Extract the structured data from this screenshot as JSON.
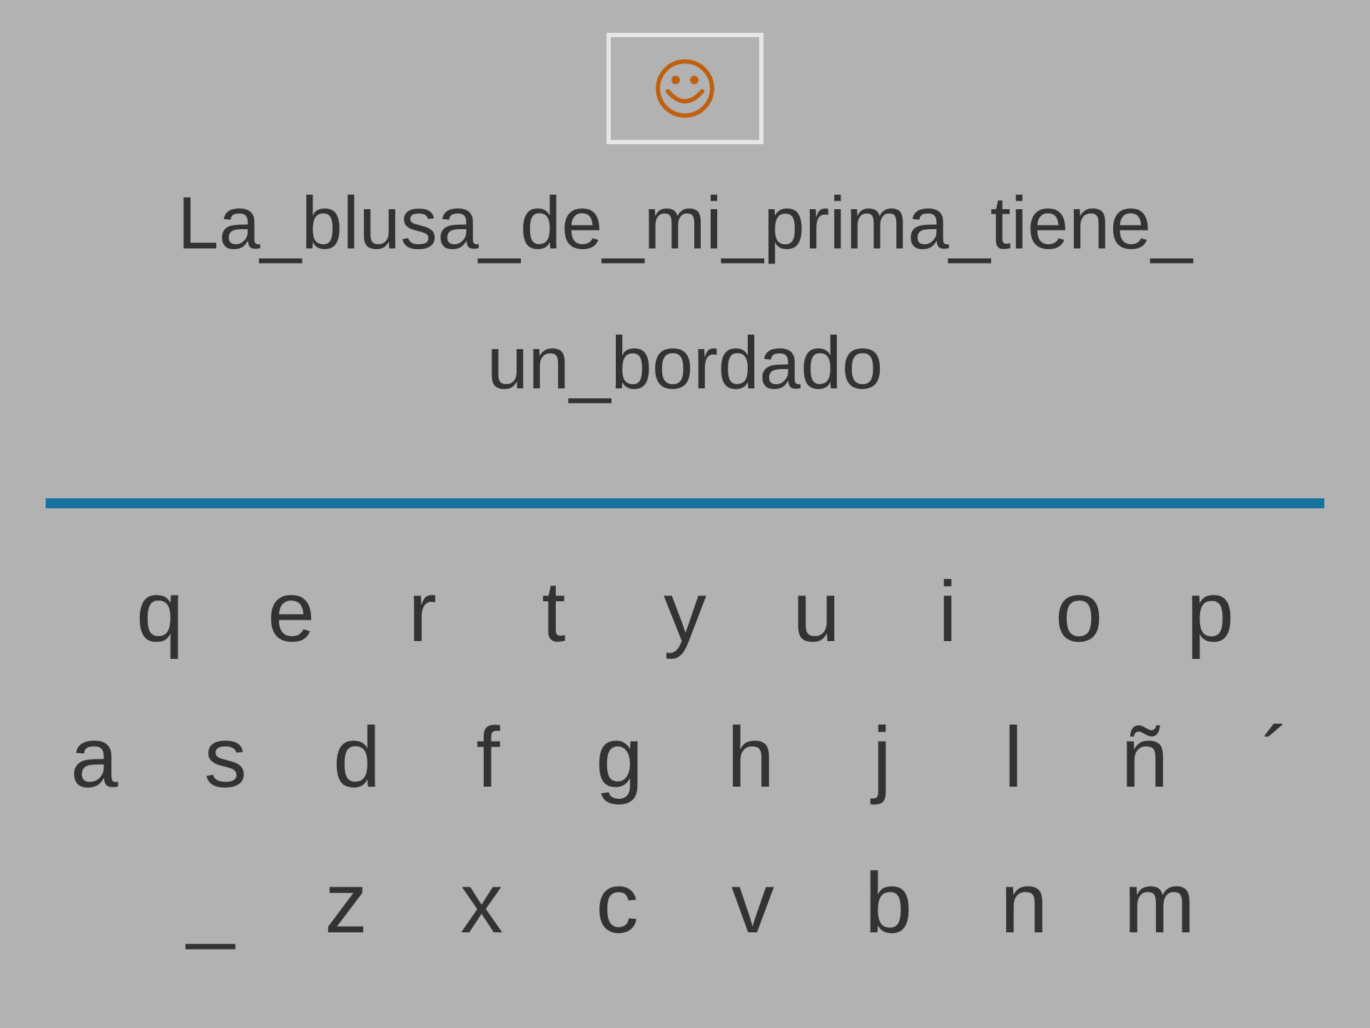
{
  "sentence_lines": [
    "La_blusa_de_mi_prima_tiene_",
    "un_bordado"
  ],
  "keyboard_rows": [
    [
      "q",
      "e",
      "r",
      "t",
      "y",
      "u",
      "i",
      "o",
      "p"
    ],
    [
      "a",
      "s",
      "d",
      "f",
      "g",
      "h",
      "j",
      "l",
      "ñ",
      "´"
    ],
    [
      "_",
      "z",
      "x",
      "c",
      "v",
      "b",
      "n",
      "m"
    ]
  ]
}
